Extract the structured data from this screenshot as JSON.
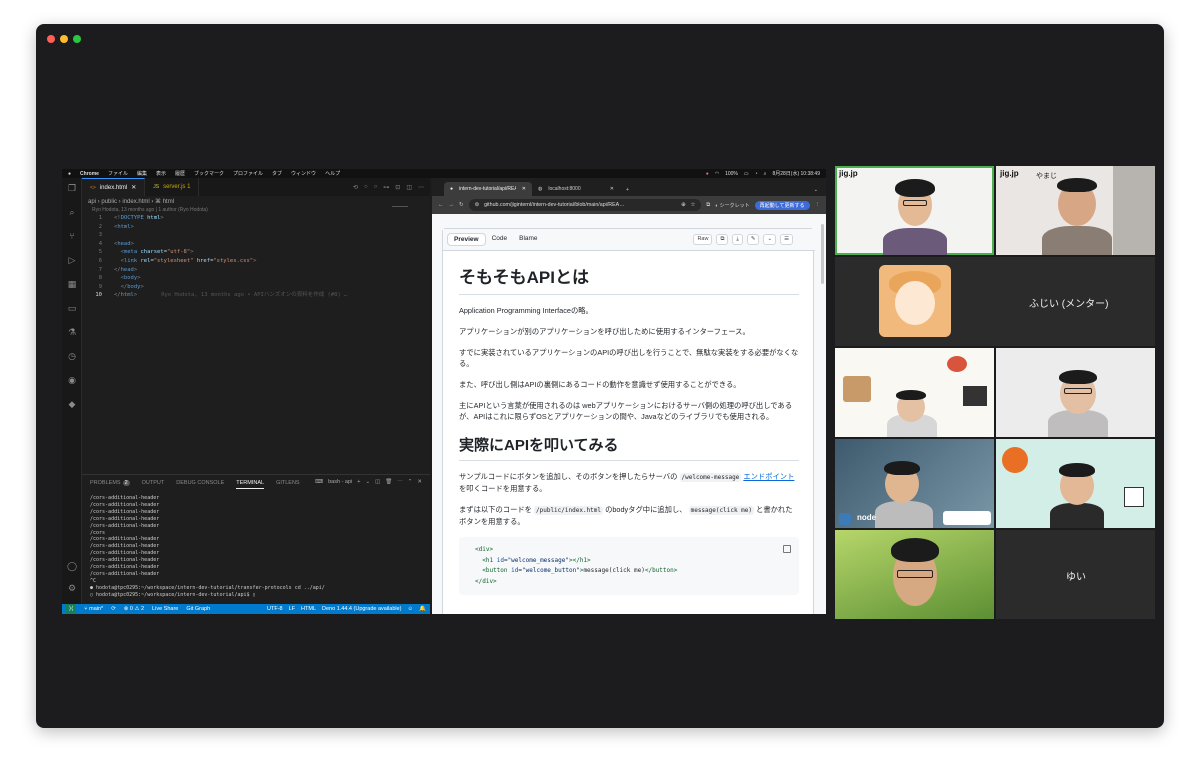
{
  "menubar": {
    "app": "Chrome",
    "items": [
      "ファイル",
      "編集",
      "表示",
      "履歴",
      "ブックマーク",
      "プロファイル",
      "タブ",
      "ウィンドウ",
      "ヘルプ"
    ],
    "battery": "100%",
    "clock": "8月28日(水) 10:38:49"
  },
  "vscode": {
    "tabs": [
      {
        "ext": "<>",
        "name": "index.html",
        "close": "✕"
      },
      {
        "ext": "JS",
        "name": "server.js 1"
      }
    ],
    "breadcrumb": "api › public › index.html › ⌘ html",
    "blame_header": "Ryo Hodota, 13 months ago | 1 author (Ryo Hodota)",
    "code_lines": [
      {
        "n": "1",
        "html": "<span class=\"punct\">&lt;!</span><span class=\"tag\">DOCTYPE</span> <span class=\"attr\">html</span><span class=\"punct\">&gt;</span>"
      },
      {
        "n": "2",
        "html": "<span class=\"punct\">&lt;</span><span class=\"tag\">html</span><span class=\"punct\">&gt;</span>"
      },
      {
        "n": "3",
        "html": ""
      },
      {
        "n": "4",
        "html": "<span class=\"punct\">&lt;</span><span class=\"tag\">head</span><span class=\"punct\">&gt;</span>"
      },
      {
        "n": "5",
        "html": "&nbsp;&nbsp;<span class=\"punct\">&lt;</span><span class=\"tag\">meta</span> <span class=\"attr\">charset</span>=<span class=\"str\">\"utf-8\"</span><span class=\"punct\">&gt;</span>"
      },
      {
        "n": "6",
        "html": "&nbsp;&nbsp;<span class=\"punct\">&lt;</span><span class=\"tag\">link</span> <span class=\"attr\">rel</span>=<span class=\"str\">\"stylesheet\"</span> <span class=\"attr\">href</span>=<span class=\"str\">\"styles.css\"</span><span class=\"punct\">&gt;</span>"
      },
      {
        "n": "7",
        "html": "<span class=\"punct\">&lt;/</span><span class=\"tag\">head</span><span class=\"punct\">&gt;</span>"
      },
      {
        "n": "8",
        "html": "&nbsp;&nbsp;<span class=\"punct\">&lt;</span><span class=\"tag\">body</span><span class=\"punct\">&gt;</span>"
      },
      {
        "n": "9",
        "html": "&nbsp;&nbsp;<span class=\"punct\">&lt;/</span><span class=\"tag\">body</span><span class=\"punct\">&gt;</span>"
      },
      {
        "n": "10",
        "html": "<span class=\"punct\">&lt;/</span><span class=\"tag\">html</span><span class=\"punct\">&gt;</span><span class=\"ghost\">Ryo Hodota, 13 months ago • APIハンズオンの資料を作成 (#8) …</span>"
      }
    ],
    "panel_tabs": {
      "problems": "PROBLEMS",
      "problems_count": "2",
      "output": "OUTPUT",
      "debug": "DEBUG CONSOLE",
      "terminal": "TERMINAL",
      "gitlens": "GITLENS"
    },
    "panel_shell": "bash - api",
    "terminal_lines": [
      "/cors-additional-header",
      "/cors-additional-header",
      "/cors-additional-header",
      "/cors-additional-header",
      "/cors-additional-header",
      "/cors",
      "/cors-additional-header",
      "/cors-additional-header",
      "/cors-additional-header",
      "/cors-additional-header",
      "/cors-additional-header",
      "/cors-additional-header",
      "^C"
    ],
    "terminal_prompt_1": "● hodota@tpc0295:~/workspace/intern-dev-tutorial/transfer-protocols cd ../api/",
    "terminal_prompt_2": "○ hodota@tpc0295:~/workspace/intern-dev-tutorial/api$ ▯",
    "status": {
      "branch": "main*",
      "sync": "⟳",
      "errors": "⊗ 0 ⚠ 2",
      "live": "Live Share",
      "graph": "Git Graph",
      "encoding": "UTF-8",
      "eol": "LF",
      "lang": "HTML",
      "deno": "Deno 1.44.4 (Upgrade available)"
    }
  },
  "chrome": {
    "tabs": [
      "intern-dev-tutorial/api/READ…",
      "localhost:8000"
    ],
    "url": "github.com/jiginternl/intern-dev-tutorial/blob/main/api/REA…",
    "incognito": "シークレット",
    "relaunch": "再起動して更新する",
    "view_tabs": {
      "preview": "Preview",
      "code": "Code",
      "blame": "Blame"
    },
    "raw": "Raw",
    "article": {
      "h1": "そもそもAPIとは",
      "p1": "Application Programming Interfaceの略。",
      "p2": "アプリケーションが別のアプリケーションを呼び出しために使用するインターフェース。",
      "p3": "すでに実装されているアプリケーションのAPIの呼び出しを行うことで、無駄な実装をする必要がなくなる。",
      "p4": "また、呼び出し側はAPIの裏側にあるコードの動作を意識せず使用することができる。",
      "p5": "主にAPIという言葉が使用されるのは webアプリケーションにおけるサーバ側の処理の呼び出しであるが、APIはこれに限らずOSとアプリケーションの間や、Javaなどのライブラリでも使用される。",
      "h2": "実際にAPIを叩いてみる",
      "p6_a": "サンプルコードにボタンを追加し、そのボタンを押したらサーバの",
      "p6_code": "/welcome-message",
      "p6_link": "エンドポイント",
      "p6_b": "を叩くコードを用意する。",
      "p7_a": "まずは以下のコードを",
      "p7_code1": "/public/index.html",
      "p7_b": "のbodyタグ中に追加し、",
      "p7_code2": "message(click me)",
      "p7_c": "と書かれたボタンを用意する。",
      "code_block": [
        "<span class=\"tag\">&lt;div&gt;</span>",
        "&nbsp;&nbsp;<span class=\"tag\">&lt;h1</span> <span class=\"attr\">id</span>=<span class=\"str\">\"welcome_message\"</span><span class=\"tag\">&gt;&lt;/h1&gt;</span>",
        "&nbsp;&nbsp;<span class=\"tag\">&lt;button</span> <span class=\"attr\">id</span>=<span class=\"str\">\"welcome_button\"</span><span class=\"tag\">&gt;</span><span class=\"txt\">message(click me)</span><span class=\"tag\">&lt;/button&gt;</span>",
        "<span class=\"tag\">&lt;/div&gt;</span>"
      ]
    }
  },
  "video": {
    "tile1_logo": "jig.jp",
    "tile2_logo": "jig.jp",
    "tile2_name": "やまじ",
    "tile_fujii_name": "ふじい (メンター)",
    "tile_yui_name": "ゆい",
    "node_label": "node",
    "colors": {
      "speaking": "#4caf50",
      "tile_bg": "#2b2b2b"
    }
  }
}
